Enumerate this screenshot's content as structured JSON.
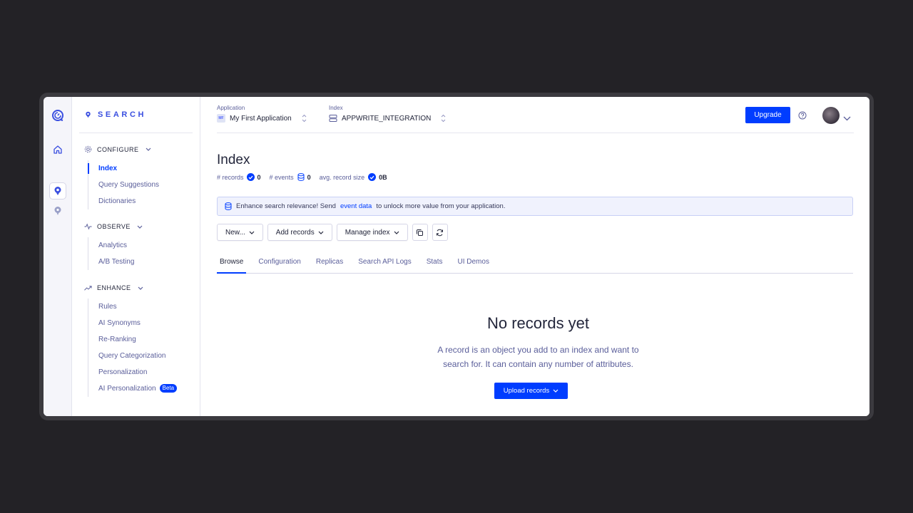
{
  "sidebar": {
    "brand": "SEARCH",
    "sections": {
      "configure": {
        "title": "CONFIGURE",
        "items": [
          "Index",
          "Query Suggestions",
          "Dictionaries"
        ]
      },
      "observe": {
        "title": "OBSERVE",
        "items": [
          "Analytics",
          "A/B Testing"
        ]
      },
      "enhance": {
        "title": "ENHANCE",
        "items": [
          "Rules",
          "AI Synonyms",
          "Re-Ranking",
          "Query Categorization",
          "Personalization",
          "AI Personalization"
        ],
        "beta_label": "Beta"
      }
    }
  },
  "topbar": {
    "application_label": "Application",
    "application_value": "My First Application",
    "application_badge": "MF",
    "index_label": "Index",
    "index_value": "APPWRITE_INTEGRATION",
    "upgrade_label": "Upgrade"
  },
  "page": {
    "title": "Index",
    "stats": {
      "records_label": "# records",
      "records_value": "0",
      "events_label": "# events",
      "events_value": "0",
      "size_label": "avg. record size",
      "size_value": "0B"
    },
    "banner": {
      "prefix": "Enhance search relevance! Send",
      "link": "event data",
      "suffix": "to unlock more value from your application."
    },
    "buttons": {
      "new": "New...",
      "add_records": "Add records",
      "manage_index": "Manage index"
    },
    "tabs": [
      "Browse",
      "Configuration",
      "Replicas",
      "Search API Logs",
      "Stats",
      "UI Demos"
    ],
    "empty": {
      "title": "No records yet",
      "line1": "A record is an object you add to an index and want to",
      "line2": "search for. It can contain any number of attributes.",
      "button": "Upload records"
    }
  },
  "colors": {
    "accent": "#003dff",
    "background": "#232226",
    "text": "#23263b",
    "muted": "#5a5e9a"
  }
}
